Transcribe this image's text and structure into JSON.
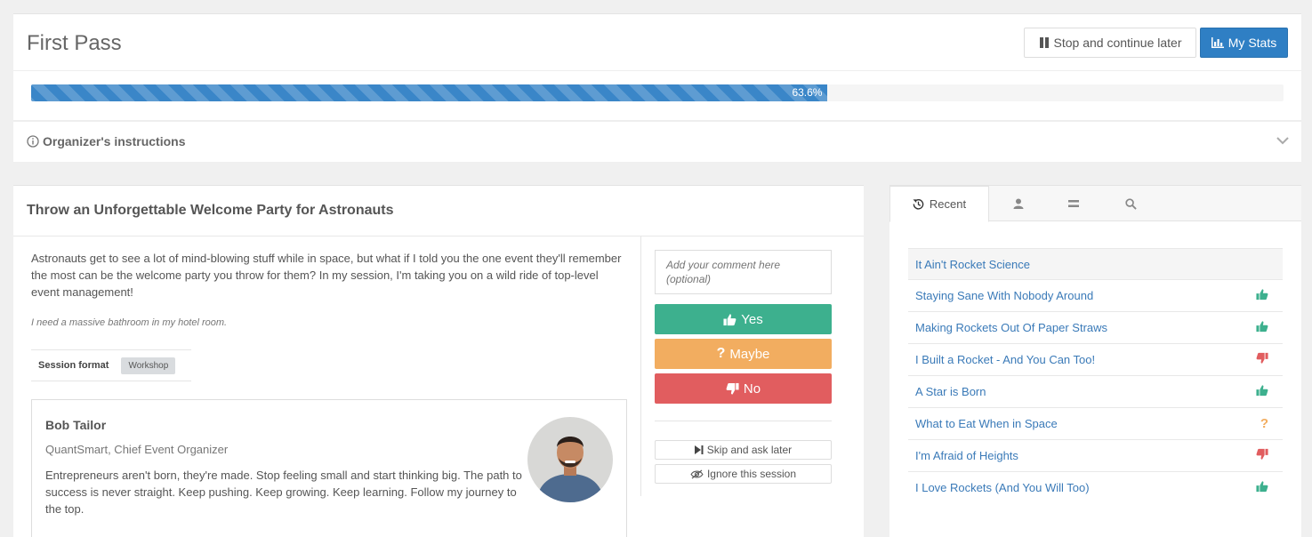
{
  "header": {
    "title": "First Pass",
    "stop_label": "Stop and continue later",
    "stats_label": "My Stats"
  },
  "progress": {
    "percent": 63.6,
    "label": "63.6%"
  },
  "instructions": {
    "label": "Organizer's instructions"
  },
  "session": {
    "title": "Throw an Unforgettable Welcome Party for Astronauts",
    "description": "Astronauts get to see a lot of mind-blowing stuff while in space, but what if I told you the one event they'll remember the most can be the welcome party you throw for them? In my session, I'm taking you on a wild ride of top-level event management!",
    "note": "I need a massive bathroom in my hotel room.",
    "format_label": "Session format",
    "format_value": "Workshop"
  },
  "speaker": {
    "name": "Bob Tailor",
    "role": "QuantSmart, Chief Event Organizer",
    "bio": "Entrepreneurs aren't born, they're made. Stop feeling small and start thinking big. The path to success is never straight. Keep pushing. Keep growing. Keep learning. Follow my journey to the top."
  },
  "voting": {
    "comment_placeholder": "Add your comment here (optional)",
    "yes_label": "Yes",
    "maybe_label": "Maybe",
    "no_label": "No",
    "skip_label": "Skip and ask later",
    "ignore_label": "Ignore this session"
  },
  "sidebar": {
    "tabs": [
      {
        "label": "Recent",
        "icon": "history-icon"
      },
      {
        "label": "",
        "icon": "user-icon"
      },
      {
        "label": "",
        "icon": "equals-icon"
      },
      {
        "label": "",
        "icon": "search-icon"
      }
    ],
    "items": [
      {
        "title": "It Ain't Rocket Science",
        "vote": ""
      },
      {
        "title": "Staying Sane With Nobody Around",
        "vote": "yes"
      },
      {
        "title": "Making Rockets Out Of Paper Straws",
        "vote": "yes"
      },
      {
        "title": "I Built a Rocket - And You Can Too!",
        "vote": "no"
      },
      {
        "title": "A Star is Born",
        "vote": "yes"
      },
      {
        "title": "What to Eat When in Space",
        "vote": "maybe"
      },
      {
        "title": "I'm Afraid of Heights",
        "vote": "no"
      },
      {
        "title": "I Love Rockets (And You Will Too)",
        "vote": "yes"
      }
    ]
  },
  "colors": {
    "primary": "#2f7fc4",
    "yes": "#3db08e",
    "maybe": "#f2ad60",
    "no": "#e15d5f"
  }
}
